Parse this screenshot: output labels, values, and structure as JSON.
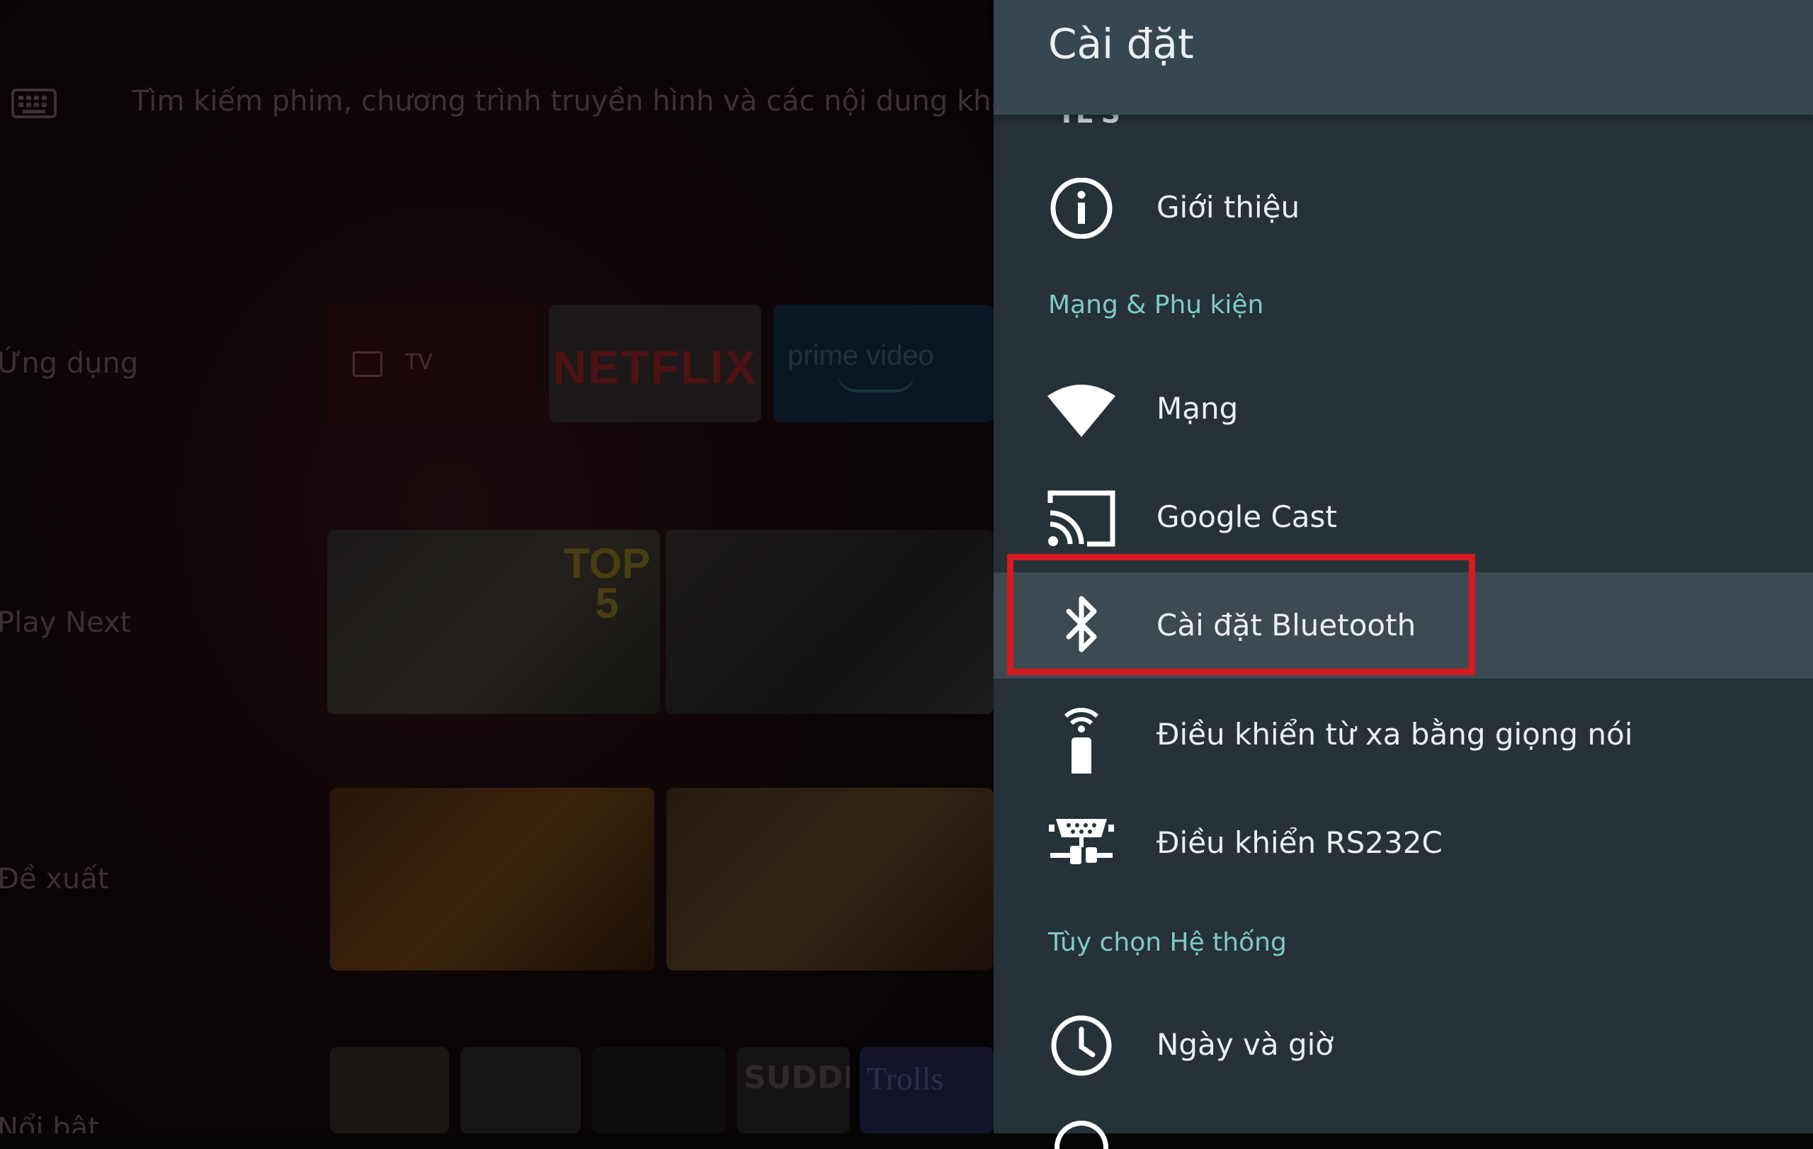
{
  "home": {
    "search_placeholder": "Tìm kiếm phim, chương trình truyền hình và các nội dung khác",
    "rows": {
      "apps": "Ứng dụng",
      "play_next": "Play Next",
      "recommended": "Đề xuất",
      "featured": "Nổi bật"
    },
    "tiles": {
      "tv": "TV",
      "netflix": "NETFLIX",
      "prime": "prime video",
      "video_badge": "TOP 5",
      "bottom_a": "SUDDEN",
      "bottom_b": "Trolls"
    }
  },
  "settings": {
    "title": "Cài đặt",
    "cut_item": "TL'S",
    "about": "Giới thiệu",
    "section_network": "Mạng & Phụ kiện",
    "network": "Mạng",
    "google_cast": "Google Cast",
    "bluetooth": "Cài đặt Bluetooth",
    "voice_remote": "Điều khiển từ xa bằng giọng nói",
    "rs232c": "Điều khiển RS232C",
    "section_system": "Tùy chọn Hệ thống",
    "date_time": "Ngày và giờ"
  },
  "icons": {
    "about": "info-icon",
    "network": "wifi-icon",
    "google_cast": "cast-icon",
    "bluetooth": "bluetooth-icon",
    "voice_remote": "remote-icon",
    "rs232c": "serial-port-icon",
    "date_time": "clock-icon"
  },
  "colors": {
    "panel_bg": "#263238",
    "header_bg": "#37474f",
    "focus_bg": "#3d4a51",
    "section_accent": "#80cbc4",
    "highlight_red": "#d71920"
  }
}
